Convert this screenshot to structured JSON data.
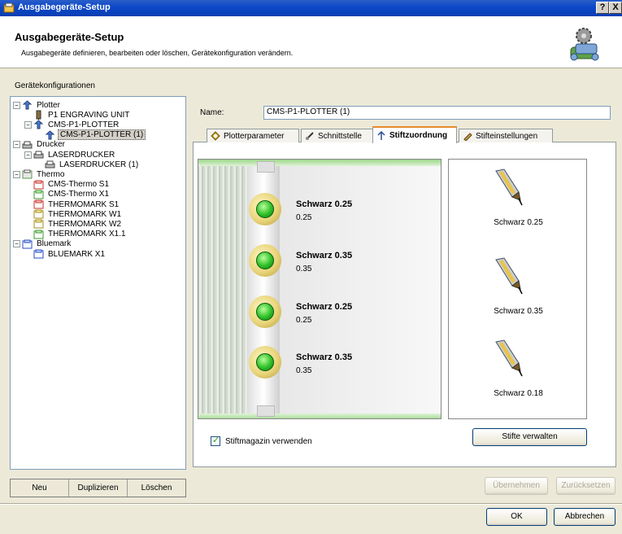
{
  "window": {
    "title": "Ausgabegeräte-Setup",
    "help_label": "?",
    "close_label": "X"
  },
  "header": {
    "title": "Ausgabegeräte-Setup",
    "subtitle": "Ausgabegeräte definieren, bearbeiten oder löschen, Gerätekonfiguration verändern."
  },
  "sidebar": {
    "section_label": "Gerätekonfigurationen",
    "tree": [
      {
        "label": "Plotter",
        "icon": "plotter-icon",
        "level": 0,
        "expander": "−"
      },
      {
        "label": "P1 ENGRAVING UNIT",
        "icon": "engraving-unit-icon",
        "level": 1,
        "expander": ""
      },
      {
        "label": "CMS-P1-PLOTTER",
        "icon": "plotter-icon",
        "level": 1,
        "expander": "−"
      },
      {
        "label": "CMS-P1-PLOTTER (1)",
        "icon": "plotter-icon",
        "level": 2,
        "expander": "",
        "selected": true
      },
      {
        "label": "Drucker",
        "icon": "printer-icon",
        "level": 0,
        "expander": "−"
      },
      {
        "label": "LASERDRUCKER",
        "icon": "printer-icon",
        "level": 1,
        "expander": "−"
      },
      {
        "label": "LASERDRUCKER (1)",
        "icon": "printer-icon",
        "level": 2,
        "expander": ""
      },
      {
        "label": "Thermo",
        "icon": "thermo-icon",
        "level": 0,
        "expander": "−"
      },
      {
        "label": "CMS-Thermo S1",
        "icon": "thermo-red-icon",
        "level": 1,
        "expander": ""
      },
      {
        "label": "CMS-Thermo X1",
        "icon": "thermo-green-icon",
        "level": 1,
        "expander": ""
      },
      {
        "label": "THERMOMARK S1",
        "icon": "thermo-red-icon",
        "level": 1,
        "expander": ""
      },
      {
        "label": "THERMOMARK W1",
        "icon": "thermo-yellow-icon",
        "level": 1,
        "expander": ""
      },
      {
        "label": "THERMOMARK W2",
        "icon": "thermo-yellow-icon",
        "level": 1,
        "expander": ""
      },
      {
        "label": "THERMOMARK X1.1",
        "icon": "thermo-green-icon",
        "level": 1,
        "expander": ""
      },
      {
        "label": "Bluemark",
        "icon": "bluemark-icon",
        "level": 0,
        "expander": "−"
      },
      {
        "label": "BLUEMARK X1",
        "icon": "bluemark-icon",
        "level": 1,
        "expander": ""
      }
    ],
    "buttons": {
      "new": "Neu",
      "duplicate": "Duplizieren",
      "delete": "Löschen"
    }
  },
  "main": {
    "name_label": "Name:",
    "name_value": "CMS-P1-PLOTTER (1)",
    "tabs": [
      {
        "label": "Plotterparameter",
        "icon": "plotter-params-icon"
      },
      {
        "label": "Schnittstelle",
        "icon": "interface-icon"
      },
      {
        "label": "Stiftzuordnung",
        "icon": "pen-assignment-icon",
        "active": true
      },
      {
        "label": "Stifteinstellungen",
        "icon": "pen-settings-icon"
      }
    ],
    "magazine_slots": [
      {
        "name": "Schwarz 0.25",
        "value": "0.25"
      },
      {
        "name": "Schwarz 0.35",
        "value": "0.35"
      },
      {
        "name": "Schwarz 0.25",
        "value": "0.25"
      },
      {
        "name": "Schwarz 0.35",
        "value": "0.35"
      }
    ],
    "pens": [
      {
        "label": "Schwarz 0.25"
      },
      {
        "label": "Schwarz 0.35"
      },
      {
        "label": "Schwarz 0.18"
      }
    ],
    "use_magazine_label": "Stiftmagazin verwenden",
    "use_magazine_checked": true,
    "manage_pens_label": "Stifte verwalten"
  },
  "footer": {
    "apply_label": "Übernehmen",
    "reset_label": "Zurücksetzen",
    "ok_label": "OK",
    "cancel_label": "Abbrechen"
  },
  "colors": {
    "titlebar": "#0b47c8",
    "active_tab_accent": "#e68b2c",
    "led_green": "#2fbf28"
  }
}
